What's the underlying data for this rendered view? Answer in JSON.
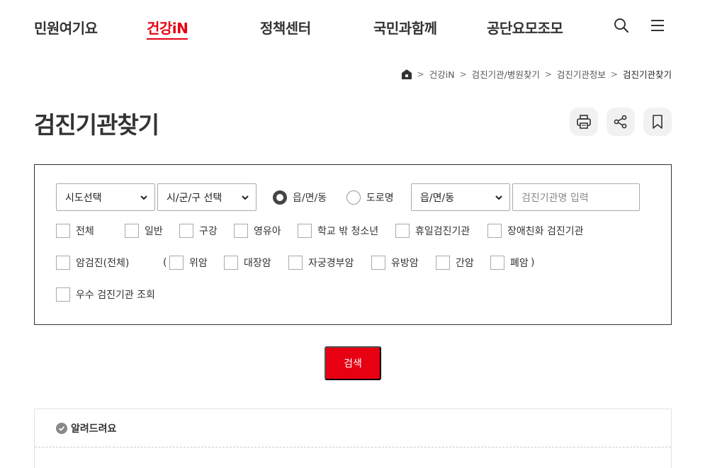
{
  "gnb": {
    "items": [
      {
        "label": "민원여기요",
        "active": false
      },
      {
        "label": "건강iN",
        "active": true
      },
      {
        "label": "정책센터",
        "active": false
      },
      {
        "label": "국민과함께",
        "active": false
      },
      {
        "label": "공단요모조모",
        "active": false
      }
    ],
    "icons": [
      "search-icon",
      "menu-icon"
    ]
  },
  "breadcrumb": {
    "home_icon": "home-icon",
    "items": [
      "건강iN",
      "검진기관/병원찾기",
      "검진기관정보",
      "검진기관찾기"
    ]
  },
  "page": {
    "title": "검진기관찾기",
    "tools": [
      "print-icon",
      "share-icon",
      "bookmark-icon"
    ]
  },
  "search": {
    "sido_select": "시도선택",
    "sigungu_select": "시/군/구 선택",
    "radio_1": "읍/면/동",
    "radio_2": "도로명",
    "radio_selected": "읍/면/동",
    "dong_select": "읍/면/동",
    "name_placeholder": "검진기관명 입력",
    "types": [
      "전체",
      "일반",
      "구강",
      "영유아",
      "학교 밖 청소년",
      "휴일검진기관",
      "장애친화 검진기관"
    ],
    "cancer_all": "암검진(전체)",
    "cancer_open": "(",
    "cancers": [
      "위암",
      "대장암",
      "자궁경부암",
      "유방암",
      "간암",
      "폐암"
    ],
    "cancer_close": ")",
    "excellent": "우수 검진기관 조회",
    "button": "검색"
  },
  "notice": {
    "title": "알려드려요"
  },
  "colors": {
    "accent": "#e60012",
    "text": "#333333",
    "border": "#333333"
  }
}
